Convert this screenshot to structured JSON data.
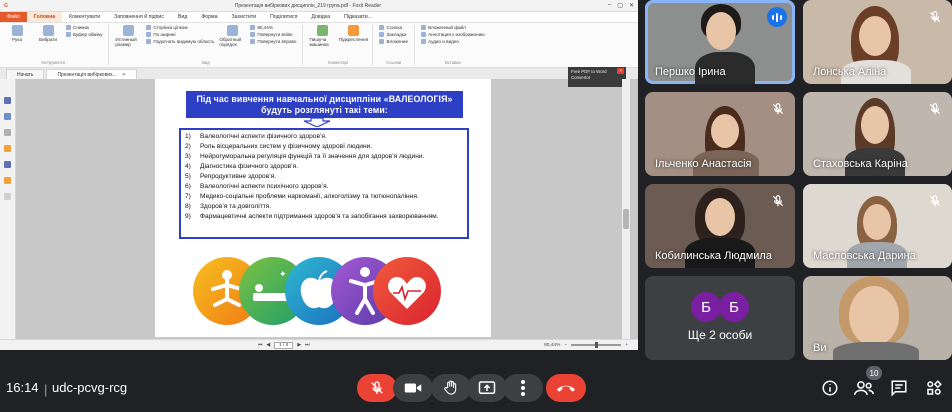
{
  "shared_screen": {
    "window_title": "Презентація вибіркових дисциплін_219 група.pdf - Foxit Reader",
    "menu": [
      "Файл",
      "Головна",
      "Коментувати",
      "Заповнення й підпис",
      "Вид",
      "Форма",
      "Захистити",
      "Поділитися",
      "Довідка",
      "Підказати..."
    ],
    "ribbon": {
      "tools": [
        {
          "label": "Рука",
          "group": "Інструменти"
        },
        {
          "label": "Вибрати",
          "group": "Інструменти"
        }
      ],
      "snapshot_list": [
        "Снимок",
        "Буфер обміну"
      ],
      "view_list": [
        "Сторінка цілком",
        "По ширині",
        "Подогнать видимую область"
      ],
      "actual_size": "Истинный размер",
      "reflow": "Обратный порядок",
      "rotate_list": [
        "80,44%",
        "Повернути вліво",
        "Повернути вправо"
      ],
      "view_group": "Вид",
      "highlight": "Підкреслення",
      "typewriter": "Пишуча машинка",
      "comment_group": "Коментарі",
      "links_list": [
        "Ссилка",
        "Закладка",
        "Вложение"
      ],
      "links_group": "Ссылки",
      "insert_list": [
        "Вложенный файл",
        "Аннотация к изображению",
        "Аудио и видео"
      ],
      "insert_group": "Вставка"
    },
    "tabs": [
      {
        "label": "Начать"
      },
      {
        "label": "Презентація вибіркових..."
      }
    ],
    "notice": {
      "line1": "Free PDF to Word",
      "line2": "Convertor",
      "close": "×"
    },
    "slide": {
      "banner": "Під час вивчення навчальної дисципліни «ВАЛЕОЛОГІЯ» будуть розглянуті такі теми:",
      "topics": [
        {
          "num": "1)",
          "text": "Валеологічні аспекти фізичного здоров’я."
        },
        {
          "num": "2)",
          "text": "Роль вісцеральних систем у фізичному здоровї людини."
        },
        {
          "num": "3)",
          "text": "Нейрогуморальна регуляція функцій та її значення для здоров’я людини."
        },
        {
          "num": "4)",
          "text": "Діагностика фізичного здоров’я."
        },
        {
          "num": "5)",
          "text": "Репродуктивне здоров’я."
        },
        {
          "num": "6)",
          "text": "Валеологічні аспекти психічного здоров’я."
        },
        {
          "num": "7)",
          "text": "Медико-соціальні проблеми наркоманії, алкоголізму та тютюнопаління."
        },
        {
          "num": "8)",
          "text": "Здоров’я та довголіття."
        },
        {
          "num": "9)",
          "text": "Фармацевтичні аспекти підтримання здоров’я та запобігання захворюванням."
        }
      ]
    },
    "status": {
      "page": "1 / 6",
      "zoom": "80,44%"
    }
  },
  "participants": [
    {
      "name": "Першко Ірина",
      "muted": false,
      "speaking": true
    },
    {
      "name": "Лонська Аліна",
      "muted": true
    },
    {
      "name": "Ільченко Анастасія",
      "muted": true
    },
    {
      "name": "Стаховська Каріна",
      "muted": true
    },
    {
      "name": "Кобилинська Людмила",
      "muted": true
    },
    {
      "name": "Масловська Дарина",
      "muted": true
    },
    {
      "name": "Ще 2 особи",
      "avatars": [
        "Б",
        "Б"
      ]
    },
    {
      "name": "Ви",
      "muted": false
    }
  ],
  "bottom_bar": {
    "time": "16:14",
    "separator": "|",
    "meeting_code": "udc-pcvg-rcg",
    "participants_count": "10",
    "controls": [
      "mic-off-icon",
      "camera-icon",
      "raise-hand-icon",
      "present-icon",
      "more-icon",
      "hang-up-icon"
    ],
    "side_controls": [
      "info-icon",
      "people-icon",
      "chat-icon",
      "activities-icon"
    ]
  },
  "colors": {
    "meet_bg": "#202124",
    "tile_bg": "#3c4043",
    "slide_blue": "#2d3fc4",
    "mic_off_red": "#ea4335",
    "speaking_blue": "#1a73e8",
    "foxit_orange": "#e25b2c"
  }
}
